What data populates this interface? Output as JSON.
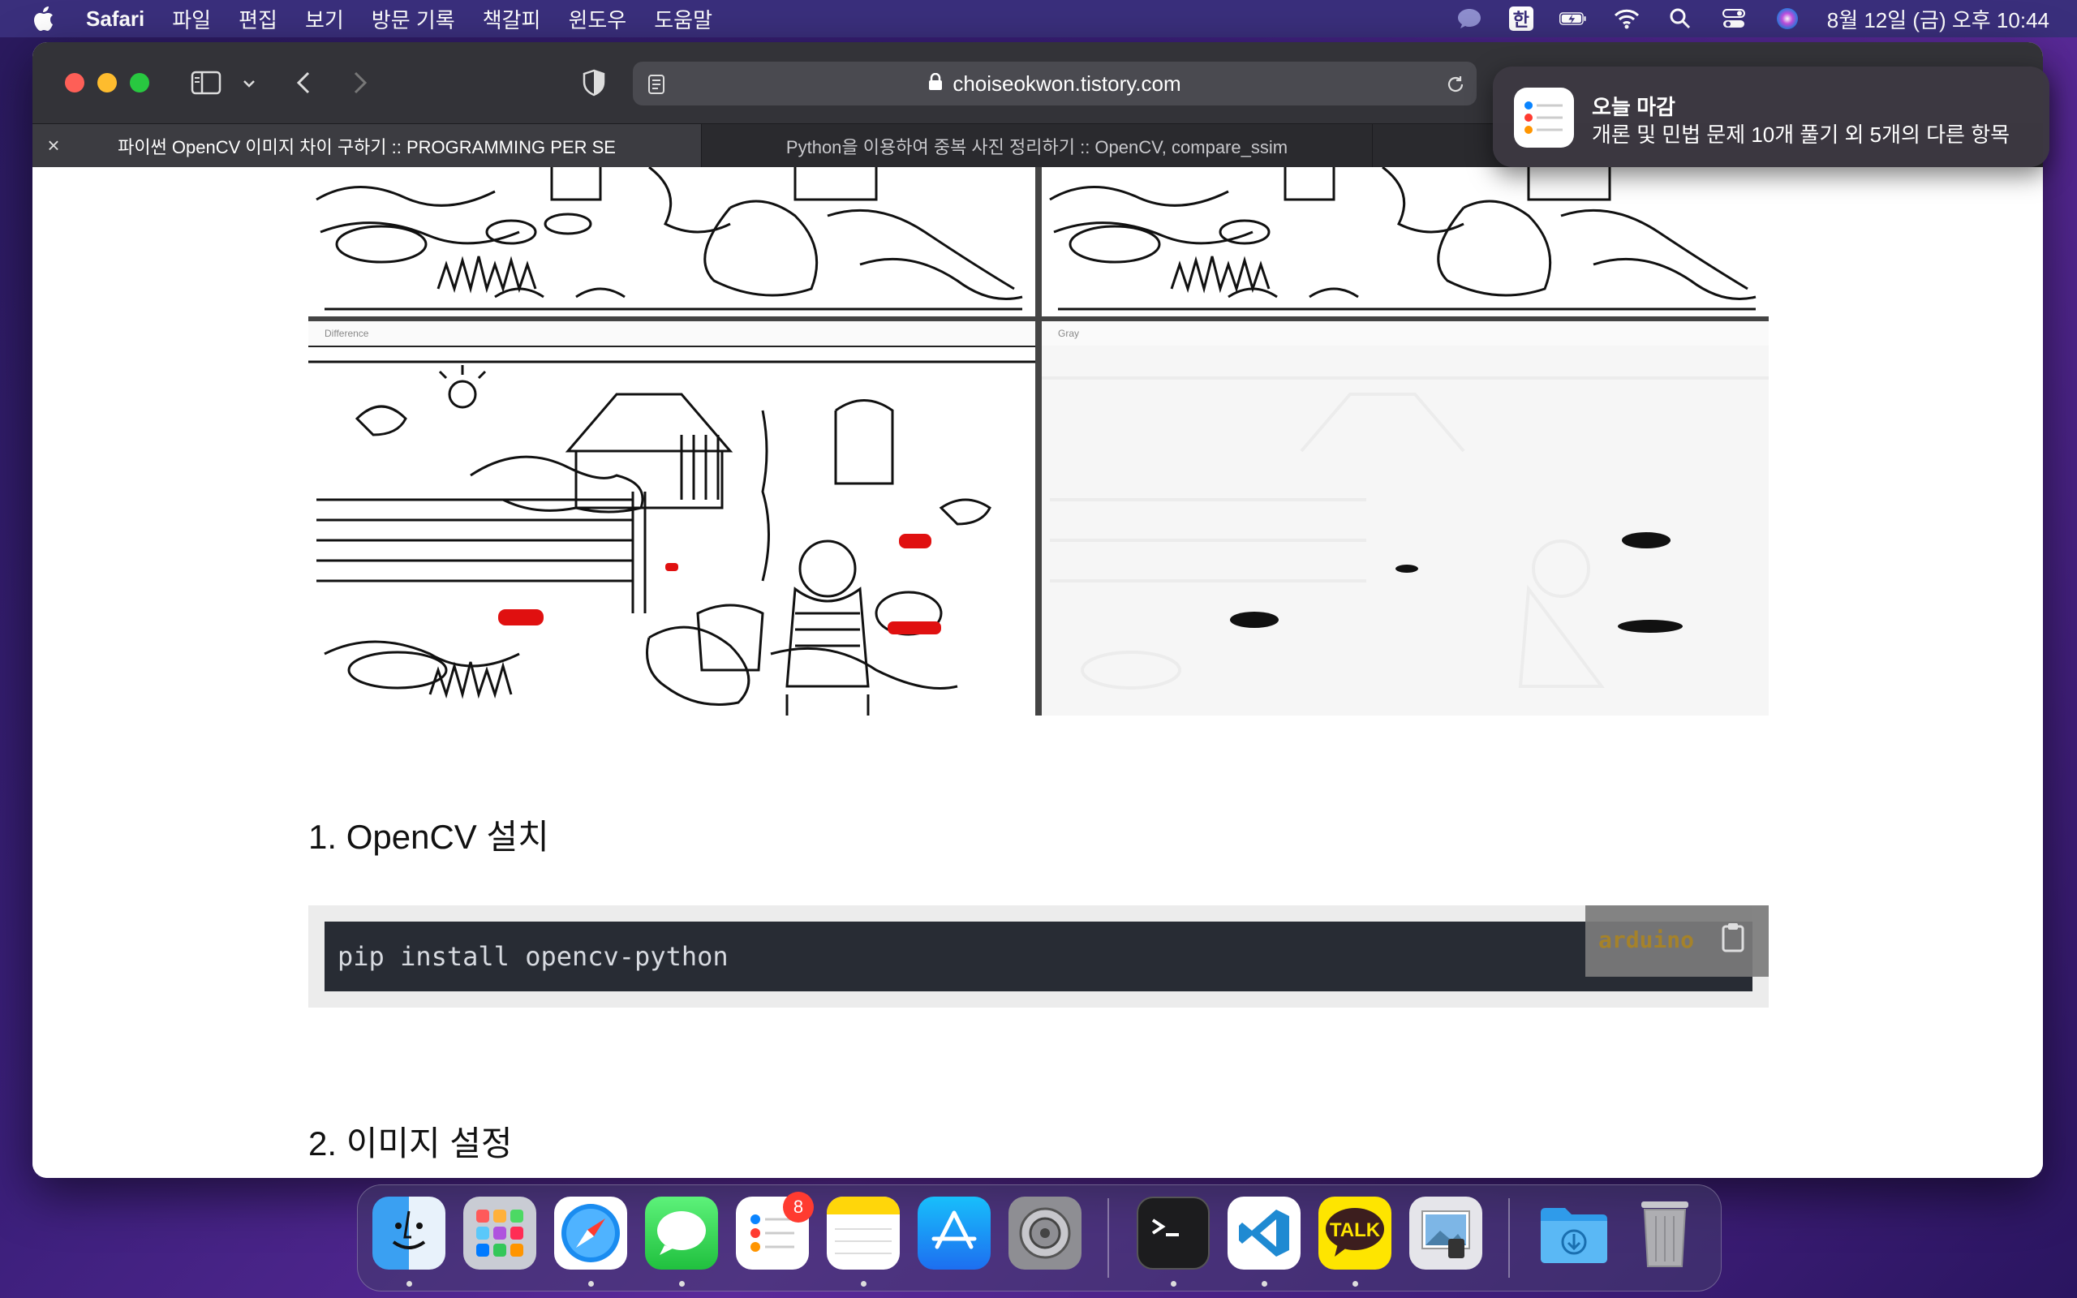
{
  "menubar": {
    "app_name": "Safari",
    "items": [
      "파일",
      "편집",
      "보기",
      "방문 기록",
      "책갈피",
      "윈도우",
      "도움말"
    ],
    "input_method": "한",
    "datetime": "8월 12일 (금) 오후  10:44"
  },
  "browser": {
    "url": "choiseokwon.tistory.com",
    "tabs": [
      {
        "title": "파이썬 OpenCV 이미지 차이 구하기 :: PROGRAMMING PER SE",
        "active": true
      },
      {
        "title": "Python을 이용하여 중복 사진 정리하기 :: OpenCV, compare_ssim",
        "active": false
      }
    ]
  },
  "article": {
    "figure_panes": [
      {
        "title": "Difference"
      },
      {
        "title": "Gray"
      }
    ],
    "heading1": "1. OpenCV 설치",
    "code": "pip install opencv-python",
    "code_lang": "arduino",
    "heading2": "2.  이미지 설정"
  },
  "notification": {
    "title": "오늘 마감",
    "body": "개론 및 민법 문제 10개 풀기 외 5개의 다른 항목"
  },
  "dock": {
    "items": [
      {
        "name": "Finder",
        "running": true
      },
      {
        "name": "Launchpad",
        "running": false
      },
      {
        "name": "Safari",
        "running": true
      },
      {
        "name": "Messages",
        "running": true
      },
      {
        "name": "Reminders",
        "running": false,
        "badge": "8"
      },
      {
        "name": "Notes",
        "running": true
      },
      {
        "name": "App Store",
        "running": false
      },
      {
        "name": "System Preferences",
        "running": false
      },
      {
        "name": "Terminal",
        "running": true
      },
      {
        "name": "Visual Studio Code",
        "running": true
      },
      {
        "name": "KakaoTalk",
        "running": true,
        "label": "TALK"
      },
      {
        "name": "Preview",
        "running": false
      },
      {
        "name": "Downloads",
        "running": false
      },
      {
        "name": "Trash",
        "running": false
      }
    ]
  },
  "colors": {
    "accent_red": "#ff3b30",
    "code_bg": "#282c34",
    "lang_label": "#b08a2a"
  }
}
